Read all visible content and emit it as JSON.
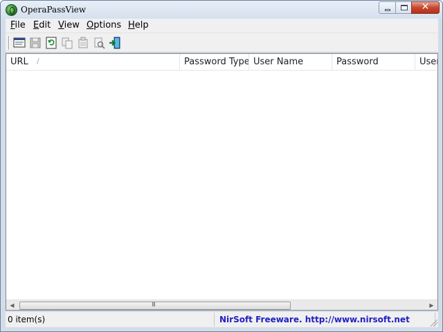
{
  "window": {
    "title": "OperaPassView",
    "close_glyph": "✕"
  },
  "menu": [
    {
      "label": "File"
    },
    {
      "label": "Edit"
    },
    {
      "label": "View"
    },
    {
      "label": "Options"
    },
    {
      "label": "Help"
    }
  ],
  "toolbar": {
    "buttons": [
      {
        "icon": "html-report-icon"
      },
      {
        "icon": "save-icon"
      },
      {
        "icon": "refresh-icon"
      },
      {
        "icon": "copy-icon"
      },
      {
        "icon": "properties-icon"
      },
      {
        "icon": "find-icon"
      },
      {
        "icon": "exit-icon"
      }
    ]
  },
  "list": {
    "columns": [
      "URL",
      "Password Type",
      "User Name",
      "Password",
      "User"
    ],
    "sort_glyph": "/",
    "rows": []
  },
  "scrollbar": {
    "left_arrow": "◀",
    "right_arrow": "▶",
    "grip": "III"
  },
  "status": {
    "count": "0 item(s)",
    "link": "NirSoft Freeware.  http://www.nirsoft.net"
  },
  "colors": {
    "accent_link": "#2020c0",
    "titlebar": "#dbe5f1"
  }
}
